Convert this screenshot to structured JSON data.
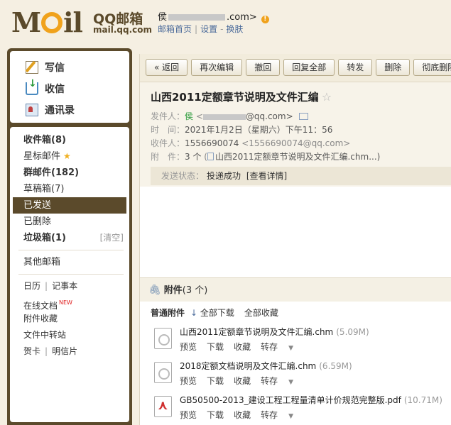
{
  "brand": {
    "logo_text": "MOIL",
    "logo_cn": "QQ邮箱",
    "domain": "mail.qq.com"
  },
  "user": {
    "name_prefix": "侯",
    "email_suffix": ".com>",
    "links": [
      "邮箱首页",
      "设置",
      "换肤"
    ]
  },
  "compose": {
    "write": "写信",
    "inbox": "收信",
    "contacts": "通讯录"
  },
  "folders": {
    "inbox": "收件箱(8)",
    "starred": "星标邮件",
    "group": "群邮件(182)",
    "drafts": "草稿箱(7)",
    "sent": "已发送",
    "deleted": "已删除",
    "spam": "垃圾箱(1)",
    "spam_clear": "[清空]",
    "other": "其他邮箱"
  },
  "tools": {
    "calendar": "日历",
    "notes": "记事本",
    "online_docs": "在线文档",
    "new_badge": "NEW",
    "attach_fav": "附件收藏",
    "file_transfer": "文件中转站",
    "greeting_card": "贺卡",
    "postcard": "明信片"
  },
  "toolbar": {
    "back": "« 返回",
    "reedit": "再次编辑",
    "recall": "撤回",
    "reply_all": "回复全部",
    "forward": "转发",
    "delete": "删除",
    "perm_delete": "彻底删除"
  },
  "mail": {
    "subject": "山西2011定额章节说明及文件汇编",
    "from_label": "发件人：",
    "from_name": "侯",
    "from_suffix": "@qq.com>",
    "time_label": "时　间：",
    "time": "2021年1月2日（星期六）下午11：56",
    "to_label": "收件人：",
    "to_name": "1556690074",
    "to_addr": "<1556690074@qq.com>",
    "attach_label": "附　件：",
    "attach_count": "3 个",
    "attach_preview": "山西2011定额章节说明及文件汇编.chm...)",
    "status_label": "发送状态：",
    "status_value": "投递成功",
    "status_link": "[查看详情]"
  },
  "attachments": {
    "title": "附件",
    "count": "(3 个)",
    "section_label": "普通附件",
    "download_all": "全部下载",
    "collect_all": "全部收藏",
    "ops": [
      "预览",
      "下载",
      "收藏",
      "转存"
    ],
    "files": [
      {
        "name": "山西2011定额章节说明及文件汇编.chm",
        "size": "(5.09M)",
        "type": "chm"
      },
      {
        "name": "2018定额文档说明及文件汇编.chm",
        "size": "(6.59M)",
        "type": "chm"
      },
      {
        "name": "GB50500-2013_建设工程工程量清单计价规范完整版.pdf",
        "size": "(10.71M)",
        "type": "pdf"
      }
    ]
  }
}
